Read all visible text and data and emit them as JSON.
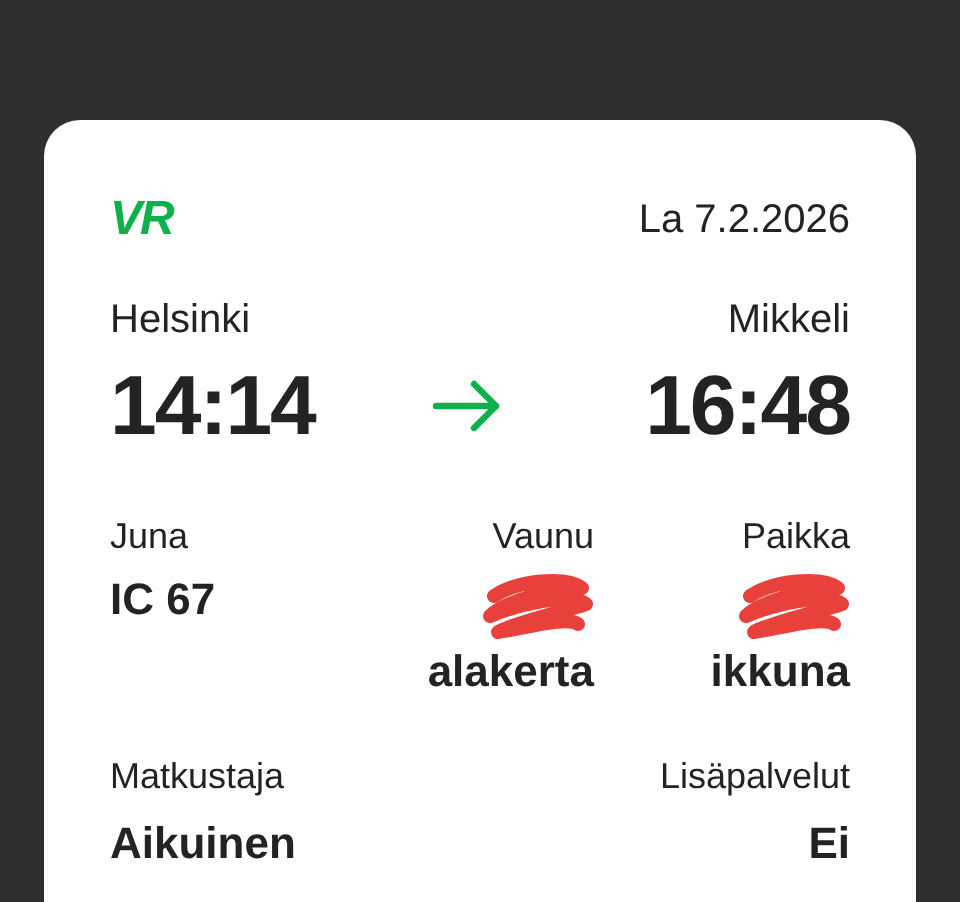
{
  "ticket": {
    "logo": "VR",
    "date": "La 7.2.2026",
    "origin": {
      "station": "Helsinki",
      "time": "14:14"
    },
    "destination": {
      "station": "Mikkeli",
      "time": "16:48"
    },
    "details": [
      {
        "label": "Juna",
        "value": "IC 67",
        "redacted": false
      },
      {
        "label": "Vaunu",
        "value": "alakerta",
        "redacted": true
      },
      {
        "label": "Paikka",
        "value": "ikkuna",
        "redacted": true
      }
    ],
    "extras": [
      {
        "label": "Matkustaja",
        "value": "Aikuinen"
      },
      {
        "label": "Lisäpalvelut",
        "value": "Ei"
      }
    ]
  }
}
